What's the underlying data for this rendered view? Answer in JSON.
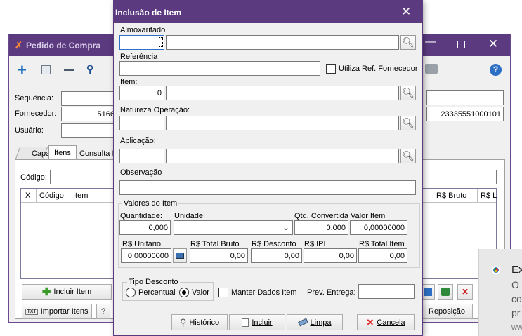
{
  "bg_window": {
    "title": "Pedido de Compra",
    "fields": {
      "sequencia_label": "Sequência:",
      "fornecedor_label": "Fornecedor:",
      "usuario_label": "Usuário:",
      "fornecedor_value": "5166",
      "cnpj_value": "23335551000101"
    },
    "tabs": [
      "Capa",
      "Itens",
      "Consulta I"
    ],
    "codigo_label": "Código:",
    "grid_columns": [
      "X",
      "Código",
      "Item"
    ],
    "grid_columns_right": [
      "R$ Bruto",
      "R$ L"
    ],
    "incluir_item_label": "Incluir Item",
    "importar_itens_label": "Importar Itens",
    "help_label": "?",
    "reposicao_label": "Reposição"
  },
  "dialog": {
    "title": "Inclusão de Item",
    "almoxarifado_label": "Almoxarifado",
    "referencia_label": "Referência",
    "utiliza_ref_label": "Utiliza Ref. Fornecedor",
    "item_label": "Item:",
    "item_value": "0",
    "natureza_label": "Natureza Operação:",
    "aplicacao_label": "Aplicação:",
    "observacao_label": "Observação",
    "valores_group": "Valores do Item",
    "quantidade_label": "Quantidade:",
    "quantidade_value": "0,000",
    "unidade_label": "Unidade:",
    "qtd_convertida_label": "Qtd. Convertida",
    "qtd_convertida_value": "0,000",
    "valor_item_label": "Valor Item",
    "valor_item_value": "0,00000000",
    "unitario_label": "R$ Unitario",
    "unitario_value": "0,00000000",
    "total_bruto_label": "R$ Total Bruto",
    "total_bruto_value": "0,00",
    "desconto_label": "R$ Desconto",
    "desconto_value": "0,00",
    "ipi_label": "R$ IPI",
    "ipi_value": "0,00",
    "total_item_label": "R$ Total Item",
    "total_item_value": "0,00",
    "tipo_desconto_group": "Tipo Desconto",
    "percentual_label": "Percentual",
    "valor_label": "Valor",
    "tipo_desconto_selected": "Valor",
    "manter_dados_label": "Manter Dados Item",
    "prev_entrega_label": "Prev. Entrega:",
    "buttons": {
      "historico": "Histórico",
      "incluir": "Incluir",
      "limpa": "Limpa",
      "cancela": "Cancela"
    }
  },
  "notification": {
    "title_fragment": "Ex",
    "lines": [
      "O",
      "co",
      "pr",
      "ww"
    ]
  },
  "colors": {
    "titlebar": "#5b3a80",
    "accent": "#2d8fd5"
  }
}
